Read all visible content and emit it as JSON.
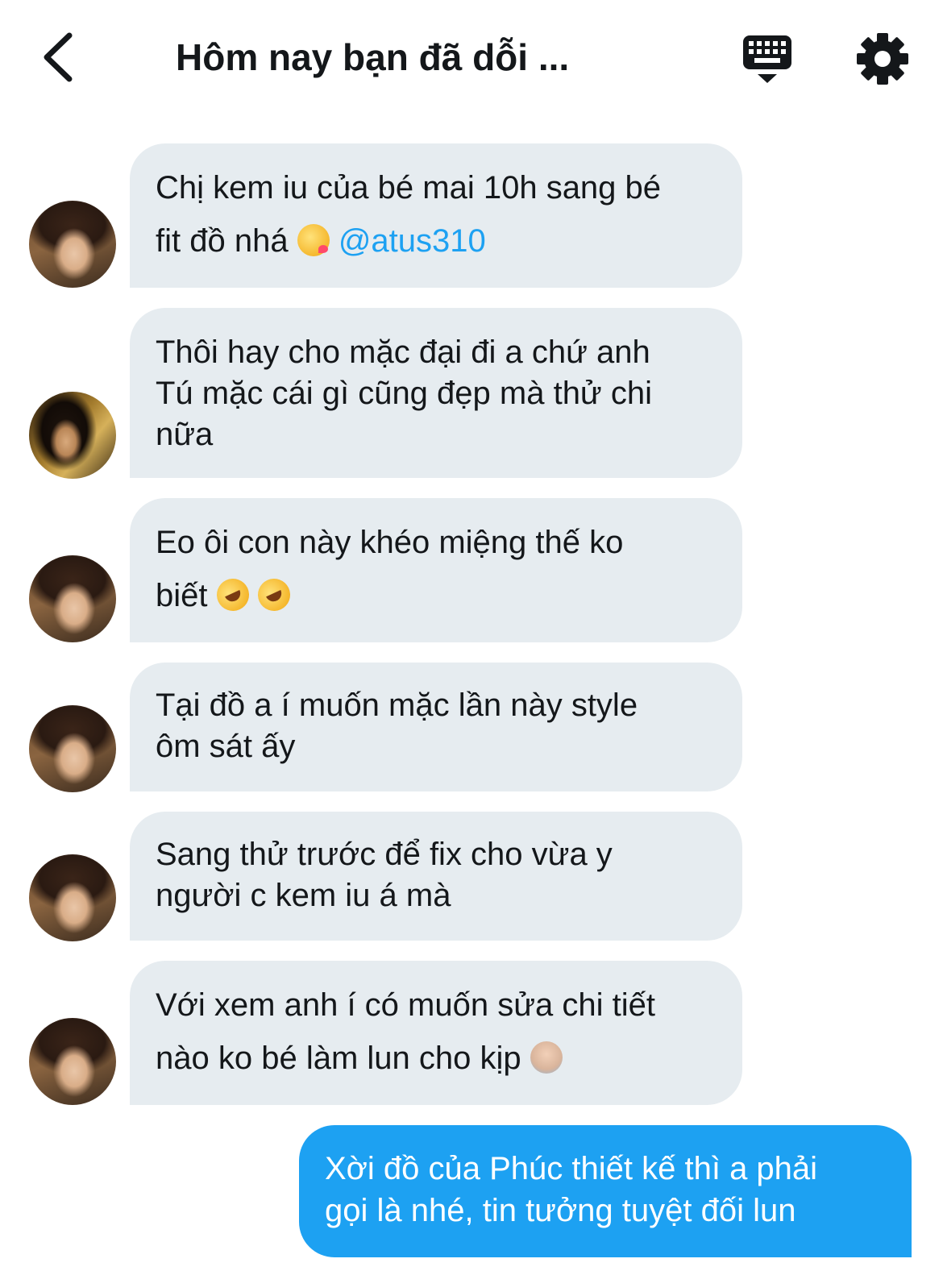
{
  "header": {
    "title": "Hôm nay bạn đã dỗi ...",
    "back_icon": "chevron-left-icon",
    "keyboard_icon": "keyboard-icon",
    "settings_icon": "gear-icon"
  },
  "messages": [
    {
      "direction": "received",
      "avatar": "avatar-a",
      "lines": [
        "Chị kem iu của bé mai 10h sang bé",
        "fit đồ nhá"
      ],
      "emoji": [
        "kissing-face-emoji"
      ],
      "mention": "@atus310"
    },
    {
      "direction": "received",
      "avatar": "avatar-b",
      "lines": [
        "Thôi hay cho mặc đại đi a chứ anh",
        "Tú mặc cái gì cũng đẹp mà thử chi",
        "nữa"
      ]
    },
    {
      "direction": "received",
      "avatar": "avatar-a",
      "lines": [
        "Eo ôi con này khéo miệng thế ko",
        "biết"
      ],
      "emoji": [
        "rofl-emoji",
        "rofl-emoji"
      ]
    },
    {
      "direction": "received",
      "avatar": "avatar-a",
      "lines": [
        "Tại đồ a í muốn mặc lần này style",
        "ôm sát ấy"
      ]
    },
    {
      "direction": "received",
      "avatar": "avatar-a",
      "lines": [
        "Sang thử trước để fix cho vừa y",
        "người c kem iu á mà"
      ]
    },
    {
      "direction": "received",
      "avatar": "avatar-a",
      "lines": [
        "Với xem anh í có muốn sửa chi tiết",
        "nào ko bé làm lun cho kịp"
      ],
      "emoji": [
        "person-gesturing-ok-emoji"
      ]
    },
    {
      "direction": "sent",
      "lines": [
        "Xời đồ của Phúc thiết kế thì a phải",
        "gọi là nhé, tin tưởng tuyệt đối lun"
      ]
    }
  ],
  "colors": {
    "received_bubble": "#e6ecf0",
    "sent_bubble": "#1da1f2",
    "mention": "#1da1f2",
    "text": "#14171a"
  }
}
